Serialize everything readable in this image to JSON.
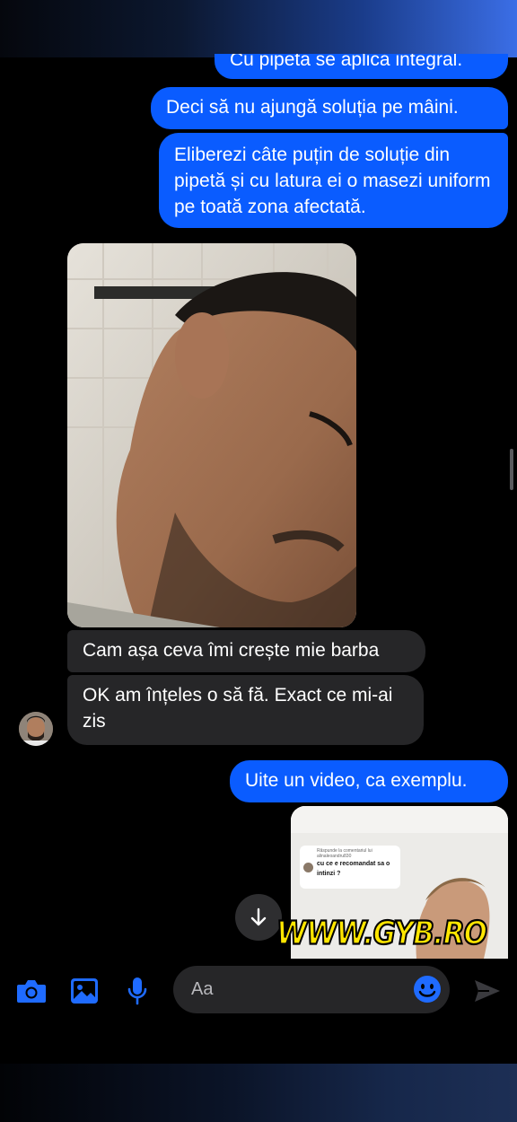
{
  "colors": {
    "outgoing": "#0a5cff",
    "incoming": "#262628",
    "accent": "#1f6bff",
    "watermark": "#ffe600"
  },
  "messages": {
    "out_clipped": "Cu pipeta se aplică integral.",
    "out_1": "Deci să nu ajungă soluția pe mâini.",
    "out_2": "Eliberezi câte puțin de soluție din pipetă și cu latura ei o masezi uniform pe toată zona afectată.",
    "photo_icon": "face-photo",
    "in_1": "Cam așa ceva îmi crește mie barba",
    "in_2": "OK am înțeles o să fă. Exact ce mi-ai zis",
    "out_3": "Uite un video, ca exemplu."
  },
  "video": {
    "reply_header": "Răspunde la comentariul lui alinaleoandru830",
    "reply_text": "cu ce e recomandat sa o intinzi ?"
  },
  "watermark": "WWW.GYB.RO",
  "composer": {
    "placeholder": "Aa",
    "icons": [
      "camera-icon",
      "image-icon",
      "microphone-icon",
      "emoji-icon",
      "send-icon"
    ]
  }
}
